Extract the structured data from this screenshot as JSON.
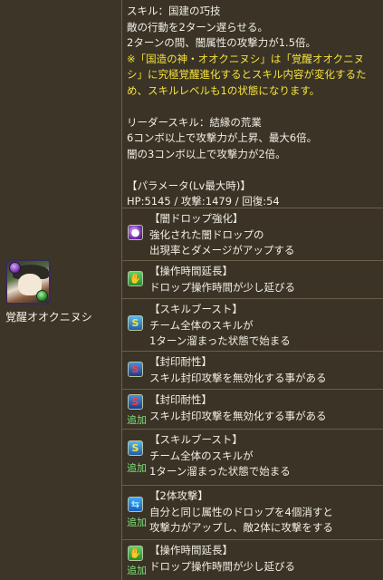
{
  "character": {
    "name": "覚醒オオクニヌシ",
    "icon": "character-portrait",
    "main_attribute_color": "#8a3cc8",
    "sub_attribute_color": "#2fa33a"
  },
  "skill": {
    "lines": [
      "スキル：国建の巧技",
      "敵の行動を2ターン遅らせる。",
      "2ターンの間、闇属性の攻撃力が1.5倍。"
    ],
    "note_lines": [
      "※「国造の神・オオクニヌシ」は「覚醒オオクニヌ",
      "シ」に究極覚醒進化するとスキル内容が変化するた",
      "め、スキルレベルも1の状態になります。"
    ],
    "leader_lines": [
      "リーダースキル：結縁の荒業",
      "6コンボ以上で攻撃力が上昇、最大6倍。",
      "闇の3コンボ以上で攻撃力が2倍。"
    ],
    "param_lines": [
      "【パラメータ(Lv最大時)】",
      "HP:5145 / 攻撃:1479 / 回復:54"
    ],
    "note_color": "#f7e23a"
  },
  "awakenings": [
    {
      "icon": "dark-orb-enhance-icon",
      "lines": [
        "【闇ドロップ強化】",
        "強化された闇ドロップの",
        "出現率とダメージがアップする"
      ],
      "added": ""
    },
    {
      "icon": "extend-time-icon",
      "lines": [
        "【操作時間延長】",
        "ドロップ操作時間が少し延びる"
      ],
      "added": ""
    },
    {
      "icon": "skill-boost-icon",
      "lines": [
        "【スキルブースト】",
        "チーム全体のスキルが",
        "1ターン溜まった状態で始まる"
      ],
      "added": ""
    },
    {
      "icon": "skill-bind-resist-icon",
      "lines": [
        "【封印耐性】",
        "スキル封印攻撃を無効化する事がある"
      ],
      "added": ""
    },
    {
      "icon": "skill-bind-resist-icon",
      "lines": [
        "【封印耐性】",
        "スキル封印攻撃を無効化する事がある"
      ],
      "added": "追加"
    },
    {
      "icon": "skill-boost-icon",
      "lines": [
        "【スキルブースト】",
        "チーム全体のスキルが",
        "1ターン溜まった状態で始まる"
      ],
      "added": "追加"
    },
    {
      "icon": "two-pronged-attack-icon",
      "lines": [
        "【2体攻撃】",
        "自分と同じ属性のドロップを4個消すと",
        "攻撃力がアップし、敵2体に攻撃をする"
      ],
      "added": "追加"
    },
    {
      "icon": "extend-time-icon",
      "lines": [
        "【操作時間延長】",
        "ドロップ操作時間が少し延びる"
      ],
      "added": "追加"
    }
  ]
}
